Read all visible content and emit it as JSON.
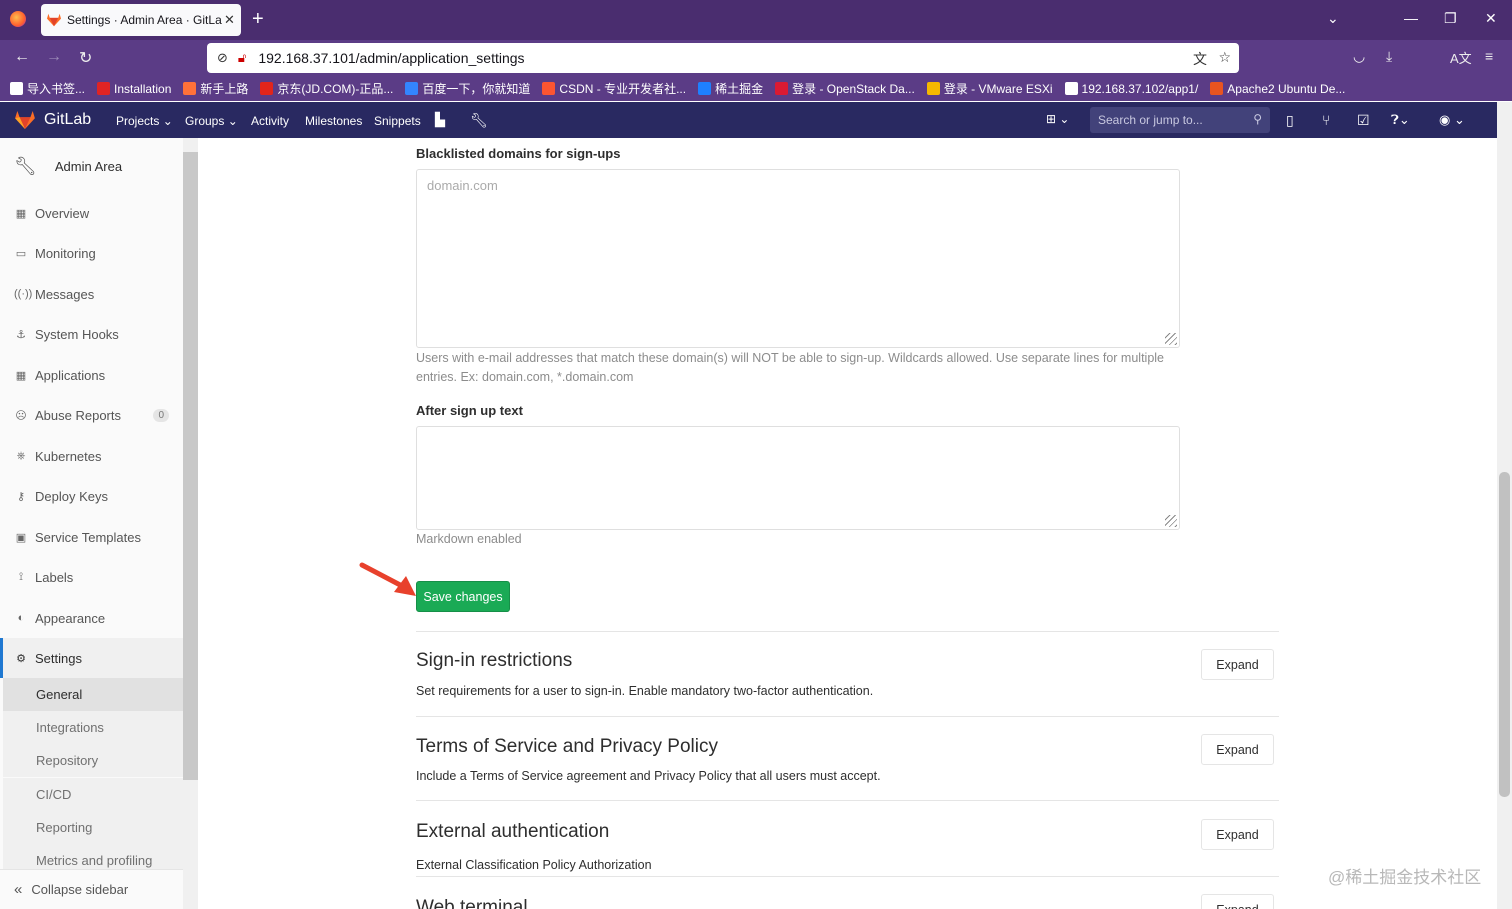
{
  "browser": {
    "tab_title": "Settings · Admin Area · GitLab",
    "url": "192.168.37.101/admin/application_settings",
    "bookmarks": [
      {
        "label": "导入书签...",
        "color": "#ffffff"
      },
      {
        "label": "Installation",
        "color": "#e02424"
      },
      {
        "label": "新手上路",
        "color": "#ff7139"
      },
      {
        "label": "京东(JD.COM)-正品...",
        "color": "#e1251b"
      },
      {
        "label": "百度一下，你就知道",
        "color": "#3385ff"
      },
      {
        "label": "CSDN - 专业开发者社...",
        "color": "#fc5531"
      },
      {
        "label": "稀土掘金",
        "color": "#1e80ff"
      },
      {
        "label": "登录 - OpenStack Da...",
        "color": "#da1a32"
      },
      {
        "label": "登录 - VMware ESXi",
        "color": "#f5b800"
      },
      {
        "label": "192.168.37.102/app1/",
        "color": "#ffffff"
      },
      {
        "label": "Apache2 Ubuntu De...",
        "color": "#e95420"
      }
    ]
  },
  "header": {
    "brand": "GitLab",
    "nav": [
      "Projects",
      "Groups",
      "Activity",
      "Milestones",
      "Snippets"
    ],
    "search_placeholder": "Search or jump to..."
  },
  "sidebar": {
    "title": "Admin Area",
    "items": [
      {
        "label": "Overview",
        "icon": "grid-icon"
      },
      {
        "label": "Monitoring",
        "icon": "monitor-icon"
      },
      {
        "label": "Messages",
        "icon": "broadcast-icon"
      },
      {
        "label": "System Hooks",
        "icon": "hook-icon"
      },
      {
        "label": "Applications",
        "icon": "apps-icon"
      },
      {
        "label": "Abuse Reports",
        "icon": "abuse-icon",
        "badge": "0"
      },
      {
        "label": "Kubernetes",
        "icon": "kubernetes-icon"
      },
      {
        "label": "Deploy Keys",
        "icon": "key-icon"
      },
      {
        "label": "Service Templates",
        "icon": "template-icon"
      },
      {
        "label": "Labels",
        "icon": "label-icon"
      },
      {
        "label": "Appearance",
        "icon": "appearance-icon"
      },
      {
        "label": "Settings",
        "icon": "gear-icon"
      }
    ],
    "subitems": [
      "General",
      "Integrations",
      "Repository",
      "CI/CD",
      "Reporting",
      "Metrics and profiling"
    ],
    "collapse": "Collapse sidebar"
  },
  "form": {
    "blacklist_label": "Blacklisted domains for sign-ups",
    "blacklist_placeholder": "domain.com",
    "blacklist_help": "Users with e-mail addresses that match these domain(s) will NOT be able to sign-up. Wildcards allowed. Use separate lines for multiple entries. Ex: domain.com, *.domain.com",
    "after_signup_label": "After sign up text",
    "after_signup_value": "",
    "markdown_help": "Markdown enabled",
    "save_label": "Save changes"
  },
  "sections": [
    {
      "title": "Sign-in restrictions",
      "desc": "Set requirements for a user to sign-in. Enable mandatory two-factor authentication.",
      "button": "Expand"
    },
    {
      "title": "Terms of Service and Privacy Policy",
      "desc": "Include a Terms of Service agreement and Privacy Policy that all users must accept.",
      "button": "Expand"
    },
    {
      "title": "External authentication",
      "desc": "External Classification Policy Authorization",
      "button": "Expand"
    },
    {
      "title": "Web terminal",
      "desc": "",
      "button": "Expand"
    }
  ],
  "watermark": "@稀土掘金技术社区"
}
